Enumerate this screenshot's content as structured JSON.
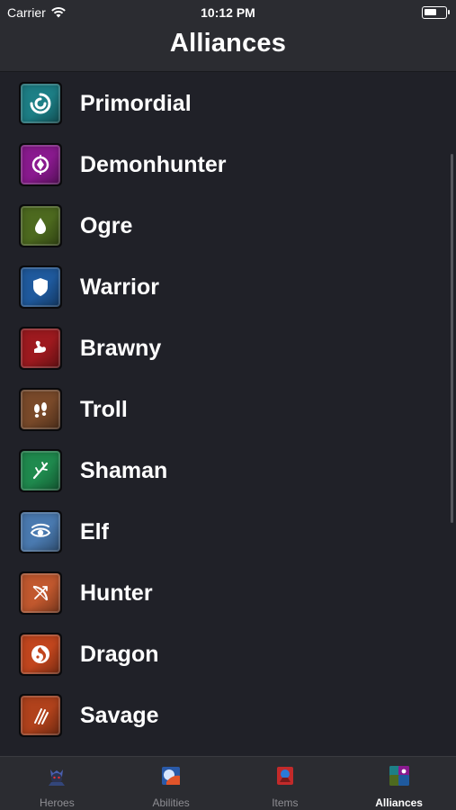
{
  "status_bar": {
    "carrier": "Carrier",
    "time": "10:12 PM",
    "battery_level": 0.6
  },
  "nav": {
    "title": "Alliances"
  },
  "alliances": [
    {
      "label": "Primordial",
      "icon": "swirl-icon",
      "color": "#1d7f86"
    },
    {
      "label": "Demonhunter",
      "icon": "eye-gem-icon",
      "color": "#8a1a8f"
    },
    {
      "label": "Ogre",
      "icon": "drop-icon",
      "color": "#4d6a1f"
    },
    {
      "label": "Warrior",
      "icon": "shield-icon",
      "color": "#1f5a9e"
    },
    {
      "label": "Brawny",
      "icon": "flexed-arm-icon",
      "color": "#9e1a1f"
    },
    {
      "label": "Troll",
      "icon": "footprints-icon",
      "color": "#7a4a2a"
    },
    {
      "label": "Shaman",
      "icon": "branch-icon",
      "color": "#1f8a4e"
    },
    {
      "label": "Elf",
      "icon": "elf-eye-icon",
      "color": "#4a7ab0"
    },
    {
      "label": "Hunter",
      "icon": "bow-icon",
      "color": "#c1582e"
    },
    {
      "label": "Dragon",
      "icon": "dragon-swirl-icon",
      "color": "#c2461e"
    },
    {
      "label": "Savage",
      "icon": "claw-marks-icon",
      "color": "#b1421c"
    }
  ],
  "tabs": [
    {
      "label": "Heroes",
      "icon": "heroes-icon",
      "active": false
    },
    {
      "label": "Abilities",
      "icon": "abilities-icon",
      "active": false
    },
    {
      "label": "Items",
      "icon": "items-icon",
      "active": false
    },
    {
      "label": "Alliances",
      "icon": "alliances-icon",
      "active": true
    }
  ]
}
